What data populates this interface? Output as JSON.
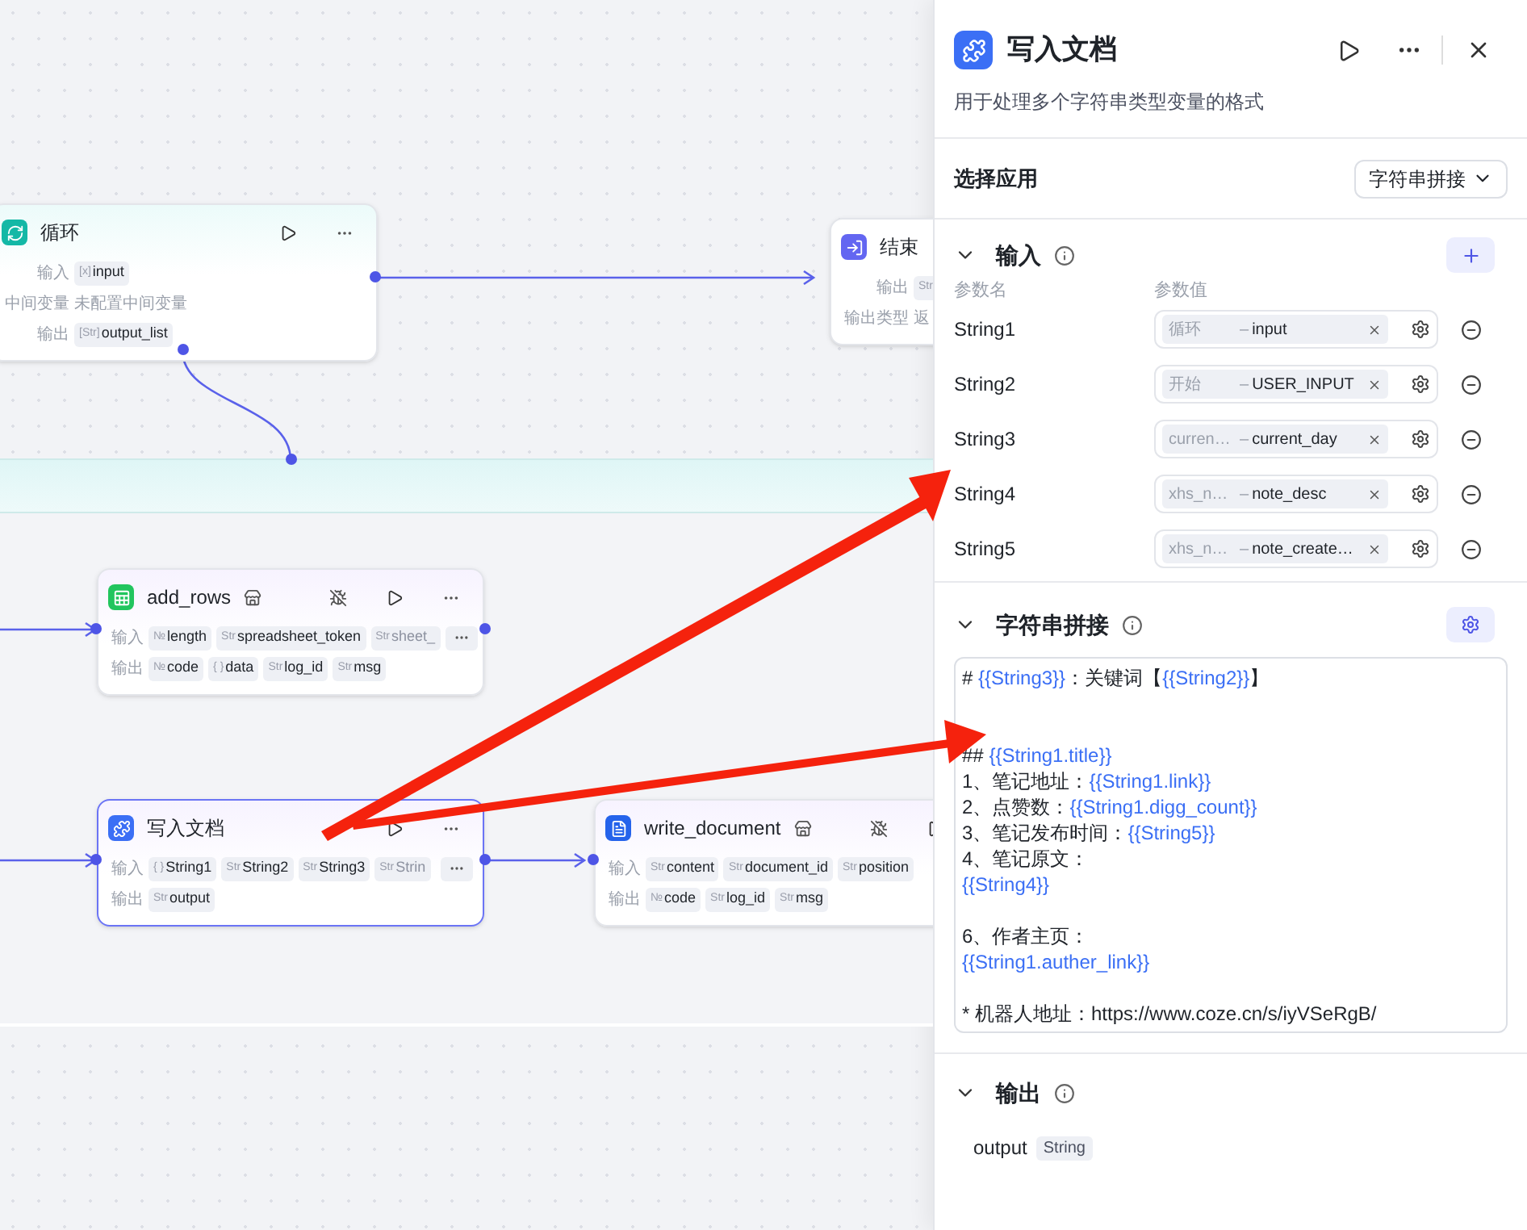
{
  "canvas": {
    "nodes": [
      {
        "kind": "loop",
        "title": "循环",
        "color": "#14b8a6",
        "selected": false,
        "rows": [
          {
            "label": "输入",
            "tags": [
              {
                "type": "[x]",
                "name": "input"
              }
            ]
          },
          {
            "label": "中间变量",
            "text": "未配置中间变量"
          },
          {
            "label": "输出",
            "tags": [
              {
                "type": "[Str]",
                "name": "output_list"
              }
            ]
          }
        ]
      },
      {
        "kind": "end",
        "title": "结束",
        "color": "#6366f1",
        "selected": false,
        "rows": [
          {
            "label": "输出",
            "tags": [
              {
                "type": "Str"
              }
            ]
          },
          {
            "label": "输出类型",
            "text": "返"
          }
        ]
      },
      {
        "kind": "plugin",
        "title": "add_rows",
        "color": "#22c55e",
        "selected": false,
        "rows": [
          {
            "label": "输入",
            "tags": [
              {
                "type": "№",
                "name": "length"
              },
              {
                "type": "Str",
                "name": "spreadsheet_token"
              }
            ],
            "faded_tag": {
              "type": "Str",
              "name": "sheet_"
            },
            "more": true
          },
          {
            "label": "输出",
            "tags": [
              {
                "type": "№",
                "name": "code"
              },
              {
                "type": "{ }",
                "name": "data"
              },
              {
                "type": "Str",
                "name": "log_id"
              },
              {
                "type": "Str",
                "name": "msg"
              }
            ]
          }
        ]
      },
      {
        "kind": "text",
        "title": "写入文档",
        "color": "#3b6ff5",
        "selected": true,
        "rows": [
          {
            "label": "输入",
            "tags": [
              {
                "type": "{ }",
                "name": "String1"
              },
              {
                "type": "Str",
                "name": "String2"
              },
              {
                "type": "Str",
                "name": "String3"
              }
            ],
            "faded_tag": {
              "type": "Str",
              "name": "Strin"
            },
            "more": true
          },
          {
            "label": "输出",
            "tags": [
              {
                "type": "Str",
                "name": "output"
              }
            ]
          }
        ]
      },
      {
        "kind": "plugin",
        "title": "write_document",
        "color": "#2563eb",
        "selected": false,
        "rows": [
          {
            "label": "输入",
            "tags": [
              {
                "type": "Str",
                "name": "content"
              },
              {
                "type": "Str",
                "name": "document_id"
              },
              {
                "type": "Str",
                "name": "position"
              }
            ]
          },
          {
            "label": "输出",
            "tags": [
              {
                "type": "№",
                "name": "code"
              },
              {
                "type": "Str",
                "name": "log_id"
              },
              {
                "type": "Str",
                "name": "msg"
              }
            ]
          }
        ]
      }
    ]
  },
  "panel": {
    "title": "写入文档",
    "description": "用于处理多个字符串类型变量的格式",
    "app_select": {
      "label": "选择应用",
      "value": "字符串拼接"
    },
    "inputs": {
      "title": "输入",
      "expanded": true,
      "columns": [
        "参数名",
        "参数值"
      ],
      "rows": [
        {
          "name": "String1",
          "source": "循环",
          "separator": "–",
          "variable": "input"
        },
        {
          "name": "String2",
          "source": "开始",
          "separator": "–",
          "variable": "USER_INPUT"
        },
        {
          "name": "String3",
          "source": "curren…",
          "separator": "–",
          "variable": "current_day"
        },
        {
          "name": "String4",
          "source": "xhs_n…",
          "separator": "–",
          "variable": "note_desc"
        },
        {
          "name": "String5",
          "source": "xhs_n…",
          "separator": "–",
          "variable": "note_create…"
        }
      ]
    },
    "concat": {
      "title": "字符串拼接",
      "expanded": true,
      "paragraphs": [
        [
          [
            {
              "kind": "text",
              "text": "# "
            },
            {
              "kind": "var",
              "text": "{{String3}}"
            },
            {
              "kind": "text",
              "text": "：关键词【"
            },
            {
              "kind": "var",
              "text": "{{String2}}"
            },
            {
              "kind": "text",
              "text": "】"
            }
          ]
        ],
        [
          [
            {
              "kind": "text",
              "text": "## "
            },
            {
              "kind": "var",
              "text": "{{String1.title}}"
            }
          ],
          [
            {
              "kind": "text",
              "text": "1、笔记地址："
            },
            {
              "kind": "var",
              "text": "{{String1.link}}"
            }
          ],
          [
            {
              "kind": "text",
              "text": "2、点赞数："
            },
            {
              "kind": "var",
              "text": "{{String1.digg_count}}"
            }
          ],
          [
            {
              "kind": "text",
              "text": "3、笔记发布时间："
            },
            {
              "kind": "var",
              "text": "{{String5}}"
            }
          ],
          [
            {
              "kind": "text",
              "text": "4、笔记原文："
            }
          ],
          [
            {
              "kind": "var",
              "text": "{{String4}}"
            }
          ]
        ],
        [
          [
            {
              "kind": "text",
              "text": "6、作者主页："
            }
          ],
          [
            {
              "kind": "var",
              "text": "{{String1.auther_link}}"
            }
          ]
        ],
        [
          [
            {
              "kind": "text",
              "text": "* 机器人地址：https://www.coze.cn/s/iyVSeRgB/"
            }
          ]
        ]
      ]
    },
    "output": {
      "title": "输出",
      "expanded": true,
      "name": "output",
      "type": "String"
    }
  }
}
